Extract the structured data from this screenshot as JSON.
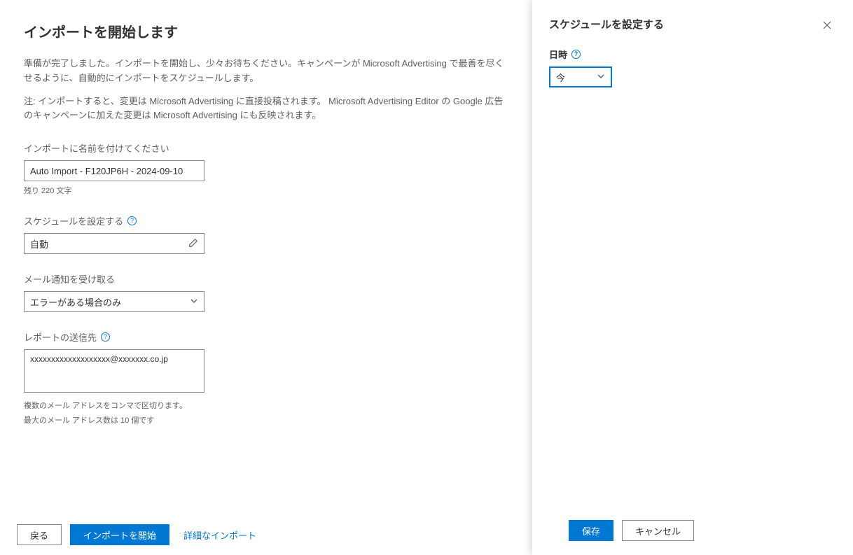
{
  "main": {
    "title": "インポートを開始します",
    "desc1": "準備が完了しました。インポートを開始し、少々お待ちください。キャンペーンが Microsoft Advertising で最善を尽くせるように、自動的にインポートをスケジュールします。",
    "desc2": "注: インポートすると、変更は Microsoft Advertising に直接投稿されます。 Microsoft Advertising Editor の Google 広告のキャンペーンに加えた変更は Microsoft Advertising にも反映されます。",
    "name_label": "インポートに名前を付けてください",
    "name_value": "Auto Import - F120JP6H - 2024-09-10",
    "name_hint": "残り 220 文字",
    "schedule_label": "スケジュールを設定する",
    "schedule_value": "自動",
    "email_notify_label": "メール通知を受け取る",
    "email_notify_value": "エラーがある場合のみ",
    "report_to_label": "レポートの送信先",
    "report_to_value": "xxxxxxxxxxxxxxxxxxx@xxxxxxx.co.jp",
    "report_hint1": "複数のメール アドレスをコンマで区切ります。",
    "report_hint2": "最大のメール アドレス数は 10 個です"
  },
  "footer": {
    "back": "戻る",
    "start": "インポートを開始",
    "advanced": "詳細なインポート"
  },
  "panel": {
    "title": "スケジュールを設定する",
    "datetime_label": "日時",
    "datetime_value": "今",
    "save": "保存",
    "cancel": "キャンセル"
  }
}
